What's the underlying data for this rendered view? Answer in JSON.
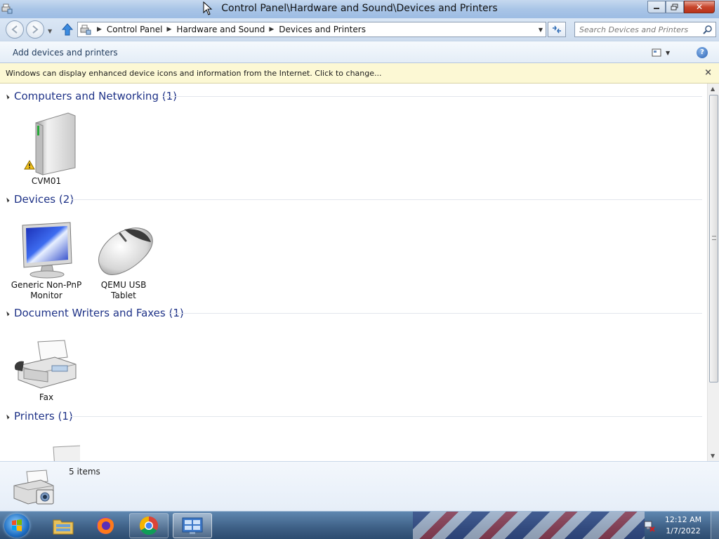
{
  "window": {
    "title": "Control Panel\\Hardware and Sound\\Devices and Printers",
    "controls": {
      "minimize": "minimize",
      "maximize": "restore",
      "close": "close"
    }
  },
  "address_bar": {
    "breadcrumbs": [
      "Control Panel",
      "Hardware and Sound",
      "Devices and Printers"
    ]
  },
  "search": {
    "placeholder": "Search Devices and Printers",
    "value": ""
  },
  "command_bar": {
    "add_label": "Add devices and printers"
  },
  "info_bar": {
    "text": "Windows can display enhanced device icons and information from the Internet. Click to change..."
  },
  "groups": [
    {
      "title": "Computers and Networking (1)",
      "items": [
        {
          "label": "CVM01",
          "icon": "computer-tower-icon",
          "warning": true
        }
      ]
    },
    {
      "title": "Devices (2)",
      "items": [
        {
          "label_line1": "Generic Non-PnP",
          "label_line2": "Monitor",
          "icon": "monitor-icon"
        },
        {
          "label_line1": "QEMU USB",
          "label_line2": "Tablet",
          "icon": "mouse-icon"
        }
      ]
    },
    {
      "title": "Document Writers and Faxes (1)",
      "items": [
        {
          "label": "Fax",
          "icon": "fax-icon"
        }
      ]
    },
    {
      "title": "Printers (1)",
      "items": [
        {
          "label": "",
          "icon": "printer-icon"
        }
      ]
    }
  ],
  "details_pane": {
    "count_text": "5 items"
  },
  "taskbar": {
    "apps": [
      "windows-explorer-icon",
      "firefox-icon",
      "chrome-icon",
      "control-panel-icon"
    ],
    "clock_time": "12:12 AM",
    "clock_date": "1/7/2022"
  },
  "colors": {
    "group_title": "#1e3287",
    "info_bar_bg": "#fcf8d4",
    "titlebar": "#a9c5e7",
    "taskbar": "#3d5f85"
  }
}
